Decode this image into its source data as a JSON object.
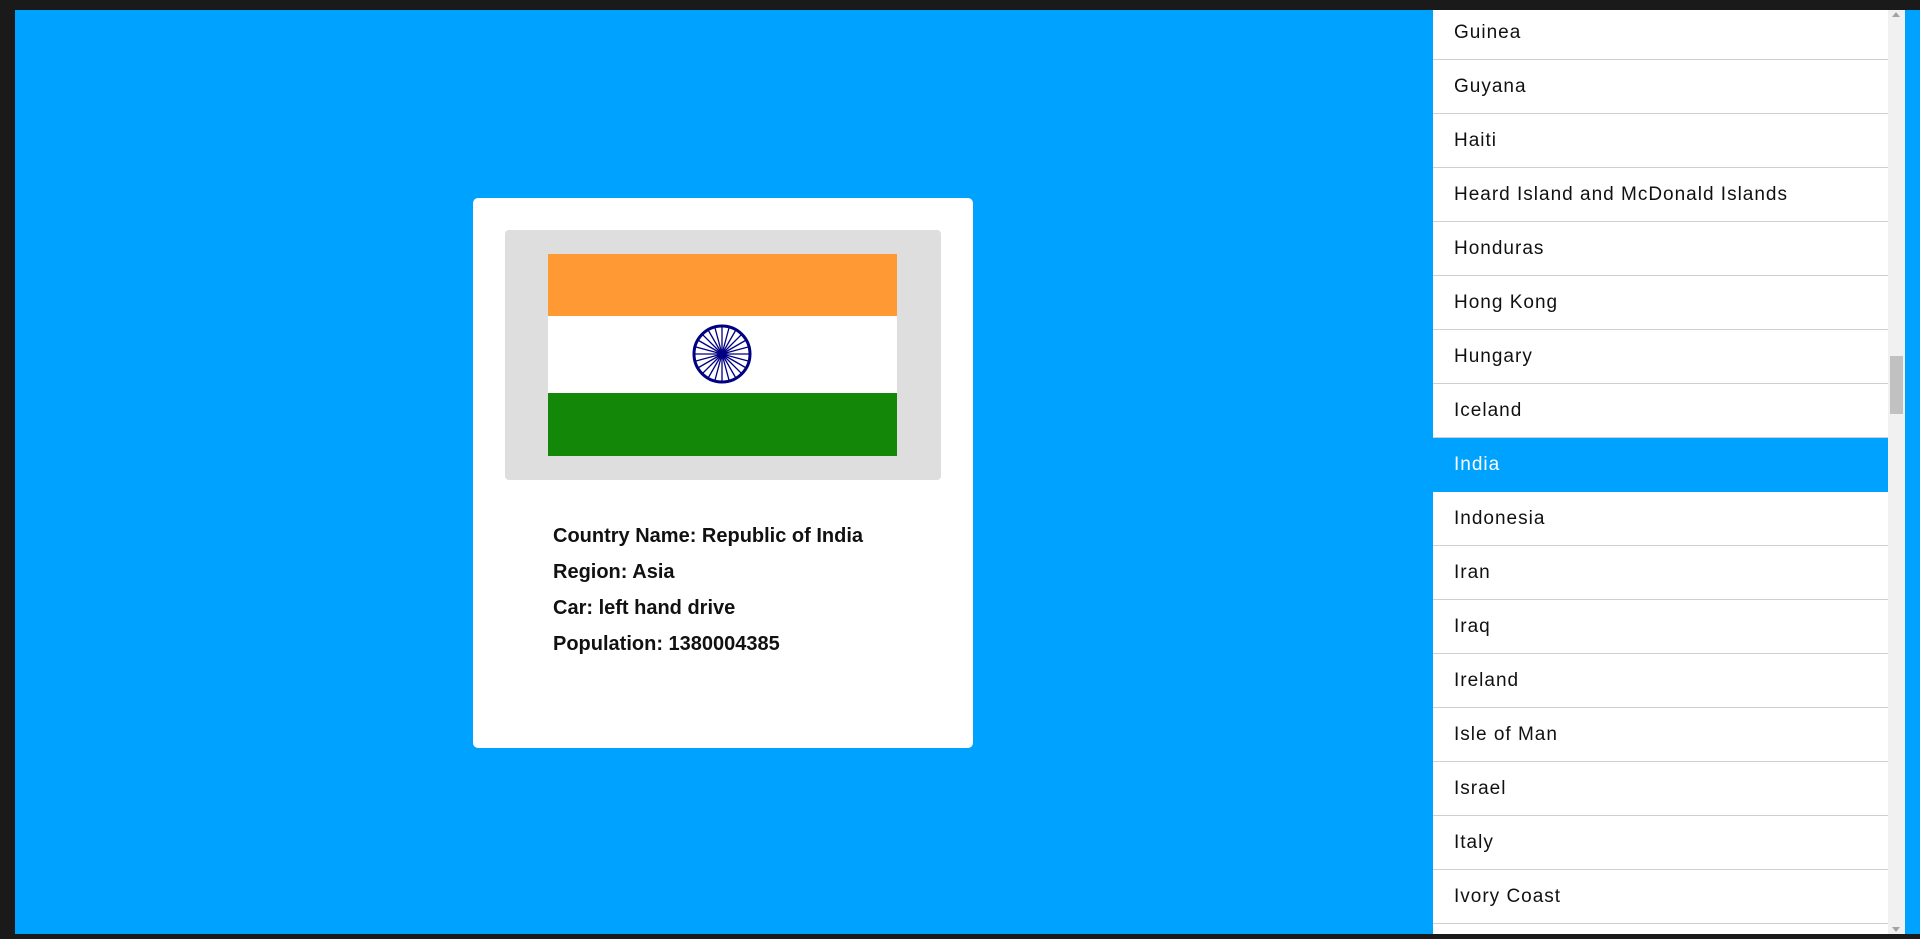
{
  "details": {
    "flag_icon": "india-flag",
    "country_name": "Country Name: Republic of India",
    "region": "Region: Asia",
    "car": "Car: left hand drive",
    "population": "Population: 1380004385"
  },
  "countries": [
    "Guinea",
    "Guyana",
    "Haiti",
    "Heard Island and McDonald Islands",
    "Honduras",
    "Hong Kong",
    "Hungary",
    "Iceland",
    "India",
    "Indonesia",
    "Iran",
    "Iraq",
    "Ireland",
    "Isle of Man",
    "Israel",
    "Italy",
    "Ivory Coast"
  ],
  "selected_country": "India",
  "colors": {
    "background": "#00a2ff",
    "selected": "#00a2ff",
    "saffron": "#ff9933",
    "green": "#138808",
    "chakra": "#000080"
  }
}
